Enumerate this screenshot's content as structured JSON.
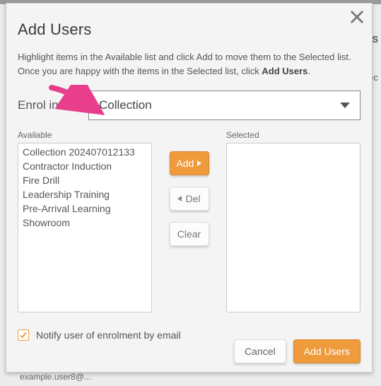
{
  "background": {
    "right_text_1": "XLS",
    "right_text_2": "elec",
    "bottom_left": "example.user8@..."
  },
  "modal": {
    "title": "Add Users",
    "instruction_pre": "Highlight items in the Available list and click Add to move them to the Selected list. Once you are happy with the items in the Selected list, click ",
    "instruction_bold": "Add Users",
    "instruction_post": ".",
    "enrol_label": "Enrol into",
    "enrol_value": "Collection",
    "available_label": "Available",
    "selected_label": "Selected",
    "available_items": [
      "Collection 202407012133",
      "Contractor Induction",
      "Fire Drill",
      "Leadership Training",
      "Pre-Arrival Learning",
      "Showroom"
    ],
    "selected_items": [],
    "add_btn": "Add",
    "del_btn": "Del",
    "clear_btn": "Clear",
    "notify_label": "Notify user of enrolment by email",
    "notify_checked": true,
    "cancel_btn": "Cancel",
    "submit_btn": "Add Users"
  },
  "colors": {
    "accent": "#ef9b3c",
    "arrow": "#e83e8c"
  }
}
